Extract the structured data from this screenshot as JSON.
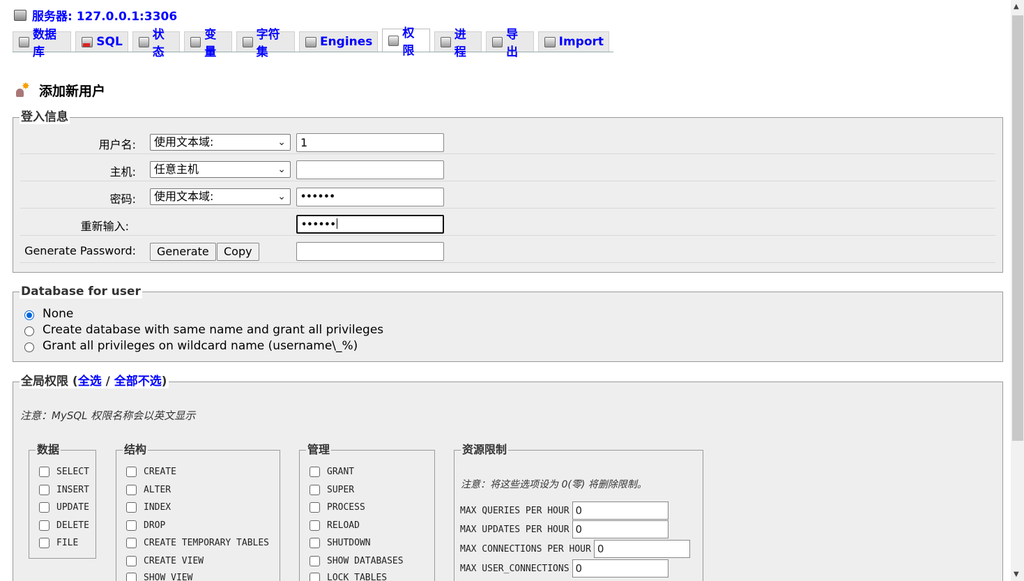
{
  "server": {
    "title": "服务器: 127.0.0.1:3306"
  },
  "tabs": [
    {
      "label": "数据库",
      "icon": "database-icon"
    },
    {
      "label": "SQL",
      "icon": "sql-icon"
    },
    {
      "label": "状态",
      "icon": "status-icon"
    },
    {
      "label": "变量",
      "icon": "variables-icon"
    },
    {
      "label": "字符集",
      "icon": "charset-icon"
    },
    {
      "label": "Engines",
      "icon": "engines-icon"
    },
    {
      "label": "权限",
      "icon": "privileges-icon",
      "active": true
    },
    {
      "label": "进程",
      "icon": "process-icon"
    },
    {
      "label": "导出",
      "icon": "export-icon"
    },
    {
      "label": "Import",
      "icon": "import-icon"
    }
  ],
  "page": {
    "title": "添加新用户"
  },
  "login": {
    "legend": "登入信息",
    "username_label": "用户名:",
    "username_select": "使用文本域:",
    "username_value": "1",
    "host_label": "主机:",
    "host_select": "任意主机",
    "host_value": "",
    "password_label": "密码:",
    "password_select": "使用文本域:",
    "password_value": "••••••",
    "reenter_label": "重新输入:",
    "reenter_value": "••••••",
    "generate_label": "Generate Password:",
    "generate_button": "Generate",
    "copy_button": "Copy",
    "generated_value": ""
  },
  "database": {
    "legend": "Database for user",
    "options": [
      {
        "label": "None",
        "checked": true
      },
      {
        "label": "Create database with same name and grant all privileges",
        "checked": false
      },
      {
        "label": "Grant all privileges on wildcard name (username\\_%)",
        "checked": false
      }
    ]
  },
  "global": {
    "legend_prefix": "全局权限 (",
    "select_all": "全选",
    "separator": " / ",
    "deselect_all": "全部不选",
    "legend_suffix": ")",
    "note": "注意：MySQL 权限名称会以英文显示",
    "data": {
      "legend": "数据",
      "items": [
        "SELECT",
        "INSERT",
        "UPDATE",
        "DELETE",
        "FILE"
      ]
    },
    "structure": {
      "legend": "结构",
      "items": [
        "CREATE",
        "ALTER",
        "INDEX",
        "DROP",
        "CREATE TEMPORARY TABLES",
        "CREATE VIEW",
        "SHOW VIEW"
      ]
    },
    "admin": {
      "legend": "管理",
      "items": [
        "GRANT",
        "SUPER",
        "PROCESS",
        "RELOAD",
        "SHUTDOWN",
        "SHOW DATABASES",
        "LOCK TABLES"
      ]
    },
    "resource": {
      "legend": "资源限制",
      "note": "注意：将这些选项设为 0(零) 将删除限制。",
      "items": [
        {
          "label": "MAX QUERIES PER HOUR",
          "value": "0"
        },
        {
          "label": "MAX UPDATES PER HOUR",
          "value": "0"
        },
        {
          "label": "MAX CONNECTIONS PER HOUR",
          "value": "0"
        },
        {
          "label": "MAX USER_CONNECTIONS",
          "value": "0"
        }
      ]
    }
  }
}
